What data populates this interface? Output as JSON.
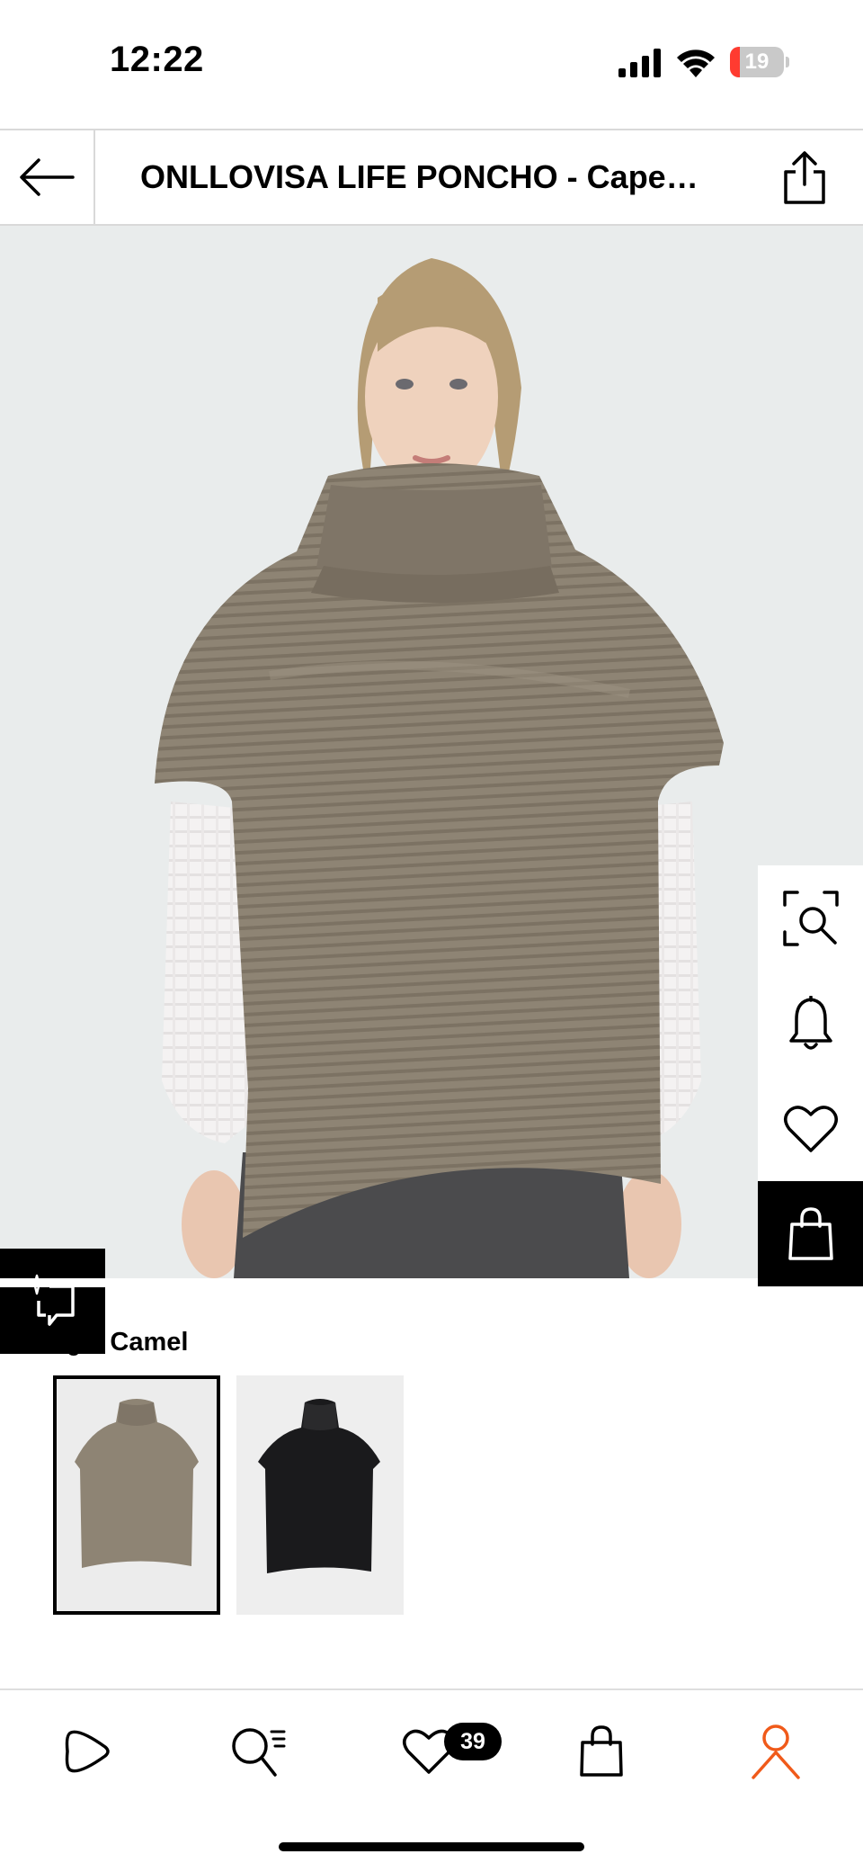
{
  "status": {
    "time": "12:22",
    "battery_level": "19",
    "battery_fraction": 0.19,
    "battery_color": "#ff3b30"
  },
  "header": {
    "title": "ONLLOVISA LIFE PONCHO - Cape…",
    "back_icon": "arrow-left-icon",
    "share_icon": "share-icon"
  },
  "product": {
    "side_actions": [
      "visual-search-icon",
      "bell-icon",
      "heart-icon",
      "shopping-bag-icon"
    ],
    "similar_icon": "sparkle-similar-icon"
  },
  "color": {
    "label": "ge: ",
    "value": "Camel",
    "swatches": [
      {
        "name": "camel",
        "color": "#8e8474",
        "selected": true
      },
      {
        "name": "black",
        "color": "#1a1a1c",
        "selected": false
      }
    ]
  },
  "tabbar": {
    "items": [
      "play-icon",
      "search-list-icon",
      "heart-icon",
      "bag-icon",
      "profile-icon"
    ],
    "wishlist_count": "39",
    "active_color": "#f05a1a"
  }
}
